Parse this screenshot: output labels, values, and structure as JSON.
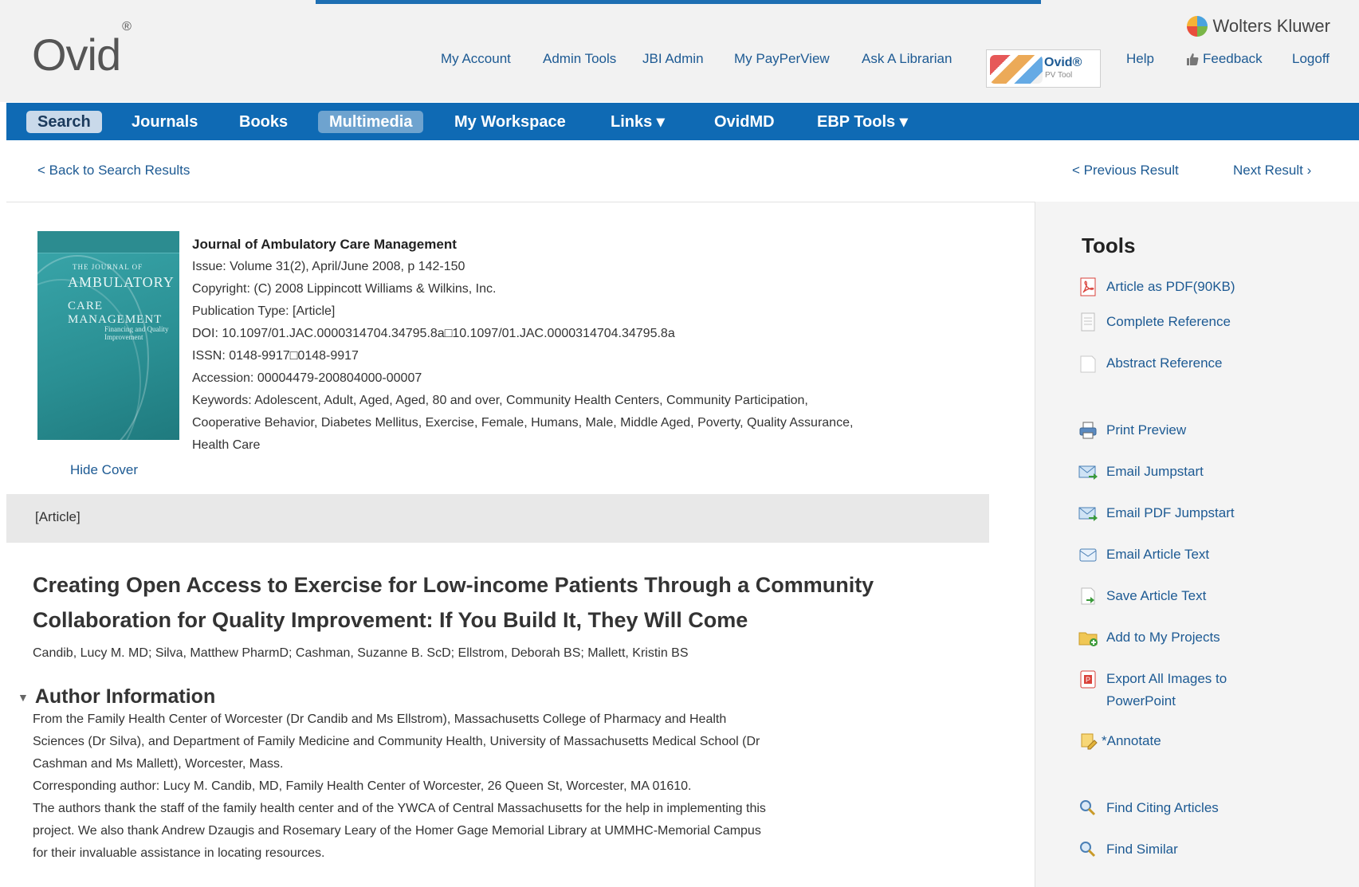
{
  "header": {
    "logo": "Ovid",
    "logo_mark": "®",
    "brand": "Wolters Kluwer",
    "links": {
      "my_account": "My Account",
      "admin_tools": "Admin Tools",
      "jbi_admin": "JBI Admin",
      "my_payperview": "My PayPerView",
      "ask_librarian": "Ask A Librarian",
      "help": "Help",
      "feedback": "Feedback",
      "logoff": "Logoff"
    },
    "pvtool": {
      "name": "Ovid®",
      "sub": "PV Tool"
    }
  },
  "nav": {
    "search": "Search",
    "journals": "Journals",
    "books": "Books",
    "multimedia": "Multimedia",
    "my_workspace": "My Workspace",
    "links": "Links ▾",
    "ovidmd": "OvidMD",
    "ebp_tools": "EBP Tools ▾"
  },
  "result_nav": {
    "back": "< Back to Search Results",
    "previous": "< Previous Result",
    "next": "Next Result ›"
  },
  "cover": {
    "line1": "AMBULATORY",
    "line2": "THE JOURNAL OF",
    "line3": "CARE MANAGEMENT",
    "line4": "Financing and Quality Improvement",
    "hide": "Hide Cover"
  },
  "citation": {
    "journal": "Journal of Ambulatory Care Management",
    "issue": "Issue: Volume 31(2), April/June 2008, p 142-150",
    "copyright": "Copyright: (C) 2008 Lippincott Williams & Wilkins, Inc.",
    "pubtype": "Publication Type: [Article]",
    "doi": "DOI: 10.1097/01.JAC.0000314704.34795.8a□10.1097/01.JAC.0000314704.34795.8a",
    "issn": "ISSN: 0148-9917□0148-9917",
    "accession": "Accession: 00004479-200804000-00007",
    "keywords1": "Keywords: Adolescent, Adult, Aged, Aged, 80 and over, Community Health Centers, Community Participation,",
    "keywords2": "Cooperative Behavior, Diabetes Mellitus, Exercise, Female, Humans, Male, Middle Aged, Poverty, Quality Assurance,",
    "keywords3": "Health Care"
  },
  "article": {
    "type": "[Article]",
    "title": "Creating Open Access to Exercise for Low-income Patients Through a Community Collaboration for Quality Improvement: If You Build It, They Will Come",
    "authors": "Candib, Lucy M. MD; Silva, Matthew PharmD; Cashman, Suzanne B. ScD; Ellstrom, Deborah BS; Mallett, Kristin BS",
    "author_info_heading": "Author Information",
    "author_info": [
      "From the Family Health Center of Worcester (Dr Candib and Ms Ellstrom), Massachusetts College of Pharmacy and Health",
      "Sciences (Dr Silva), and Department of Family Medicine and Community Health, University of Massachusetts Medical School (Dr",
      "Cashman and Ms Mallett), Worcester, Mass.",
      "Corresponding author: Lucy M. Candib, MD, Family Health Center of Worcester, 26 Queen St, Worcester, MA 01610.",
      "The authors thank the staff of the family health center and of the YWCA of Central Massachusetts for the help in implementing this",
      "project. We also thank Andrew Dzaugis and Rosemary Leary of the Homer Gage Memorial Library at UMMHC-Memorial Campus",
      "for their invaluable assistance in locating resources."
    ]
  },
  "tools": {
    "heading": "Tools",
    "items": [
      {
        "label": "Article as PDF(90KB)",
        "icon": "pdf-icon",
        "color": "#d9413a"
      },
      {
        "label": "Complete Reference",
        "icon": "document-icon",
        "color": "#b9b9b9"
      },
      {
        "label": "Abstract Reference",
        "icon": "blank-document-icon",
        "color": "#c8c8c8"
      },
      {
        "label": "Print Preview",
        "icon": "printer-icon",
        "color": "#4a7fb5"
      },
      {
        "label": "Email Jumpstart",
        "icon": "email-arrow-icon",
        "color": "#4a9be0"
      },
      {
        "label": "Email PDF Jumpstart",
        "icon": "email-arrow-icon",
        "color": "#4a9be0"
      },
      {
        "label": "Email Article Text",
        "icon": "email-icon",
        "color": "#4a7fb5"
      },
      {
        "label": "Save Article Text",
        "icon": "save-icon",
        "color": "#3a9a3a"
      },
      {
        "label": "Add to My Projects",
        "icon": "folder-add-icon",
        "color": "#e2b33a"
      },
      {
        "label": "Export All Images to",
        "label2": "PowerPoint",
        "icon": "powerpoint-icon",
        "color": "#d9413a"
      },
      {
        "label": "*Annotate",
        "icon": "annotate-icon",
        "color": "#e2b33a"
      },
      {
        "label": "Find Citing Articles",
        "icon": "magnifier-icon",
        "color": "#4a7fb5"
      },
      {
        "label": "Find Similar",
        "icon": "magnifier-icon",
        "color": "#4a7fb5"
      }
    ]
  }
}
